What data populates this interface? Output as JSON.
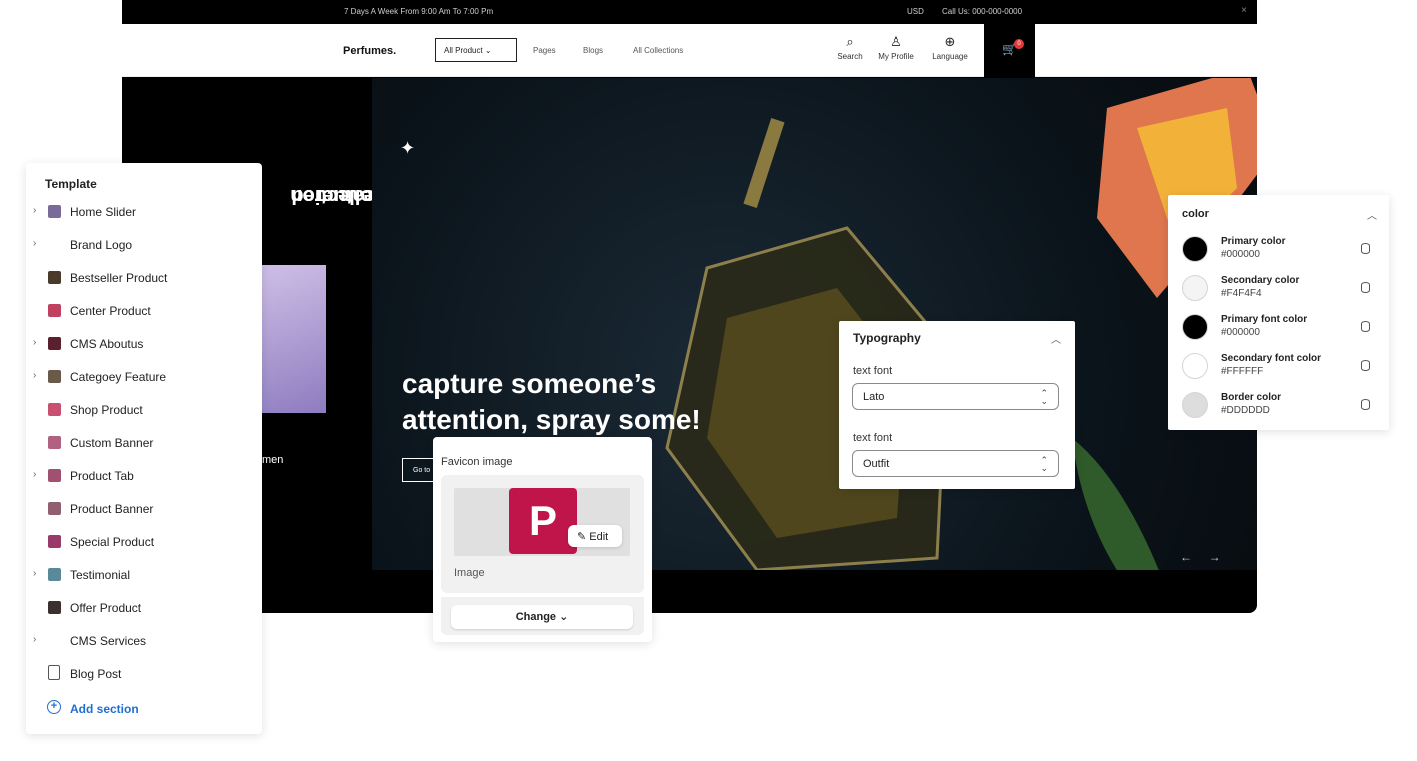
{
  "topbar": {
    "promo": "7 Days A Week From 9:00 Am To 7:00 Pm",
    "currency": "USD",
    "call": "Call Us: 000-000-0000"
  },
  "nav": {
    "logo": "Perfumes.",
    "all_product": "All Product",
    "links": [
      "Pages",
      "Blogs",
      "All Collections"
    ],
    "tools": [
      {
        "label": "Search",
        "icon": "search-icon"
      },
      {
        "label": "My Profile",
        "icon": "user-icon"
      },
      {
        "label": "Language",
        "icon": "globe-icon"
      }
    ],
    "cart_count": "0"
  },
  "hero": {
    "side_title_1": "Featuered",
    "side_title_2": "Collection",
    "side_label": "men",
    "headline_line1": "capture someone’s",
    "headline_line2": "attention, spray some!",
    "button": "Go to",
    "prev": "←",
    "next": "→"
  },
  "template": {
    "title": "Template",
    "items": [
      {
        "label": "Home Slider",
        "expandable": true,
        "thumb": "#7a6a9a"
      },
      {
        "label": "Brand Logo",
        "expandable": true,
        "thumb": ""
      },
      {
        "label": "Bestseller Product",
        "expandable": false,
        "thumb": "#4a3a2a"
      },
      {
        "label": "Center Product",
        "expandable": false,
        "thumb": "#c04060"
      },
      {
        "label": "CMS Aboutus",
        "expandable": true,
        "thumb": "#5a2030"
      },
      {
        "label": "Categoey Feature",
        "expandable": true,
        "thumb": "#6a5a4a"
      },
      {
        "label": "Shop Product",
        "expandable": false,
        "thumb": "#c85070"
      },
      {
        "label": "Custom Banner",
        "expandable": false,
        "thumb": "#b06080"
      },
      {
        "label": "Product Tab",
        "expandable": true,
        "thumb": "#a05070"
      },
      {
        "label": "Product Banner",
        "expandable": false,
        "thumb": "#906070"
      },
      {
        "label": "Special Product",
        "expandable": false,
        "thumb": "#9a3a6a"
      },
      {
        "label": "Testimonial",
        "expandable": true,
        "thumb": "#5a8a9a"
      },
      {
        "label": "Offer Product",
        "expandable": false,
        "thumb": "#3a3030"
      },
      {
        "label": "CMS Services",
        "expandable": true,
        "thumb": ""
      },
      {
        "label": "Blog Post",
        "expandable": false,
        "thumb": "doc"
      }
    ],
    "add_section": "Add section"
  },
  "favicon": {
    "title": "Favicon image",
    "letter": "P",
    "edit": "Edit",
    "image_label": "Image",
    "change": "Change"
  },
  "typography": {
    "title": "Typography",
    "fields": [
      {
        "label": "text font",
        "value": "Lato"
      },
      {
        "label": "text font",
        "value": "Outfit"
      }
    ]
  },
  "color": {
    "title": "color",
    "items": [
      {
        "name": "Primary color",
        "hex": "#000000"
      },
      {
        "name": "Secondary color",
        "hex": "#F4F4F4"
      },
      {
        "name": "Primary font color",
        "hex": "#000000"
      },
      {
        "name": "Secondary font color",
        "hex": "#FFFFFF"
      },
      {
        "name": "Border color",
        "hex": "#DDDDDD"
      }
    ]
  }
}
